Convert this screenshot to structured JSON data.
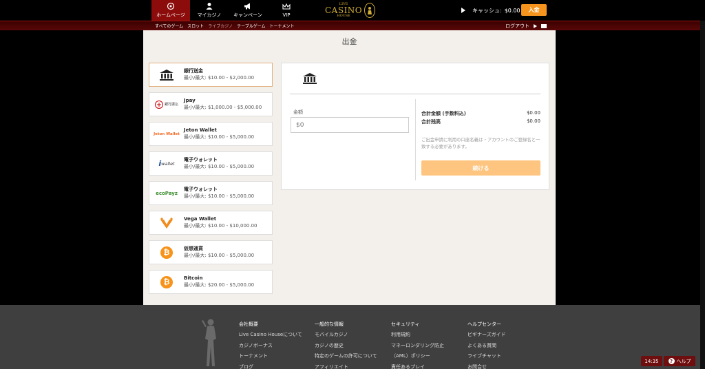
{
  "nav": {
    "items": [
      {
        "label": "ホームページ",
        "icon": "home-icon"
      },
      {
        "label": "マイカジノ",
        "icon": "user-icon"
      },
      {
        "label": "キャンペーン",
        "icon": "megaphone-icon"
      },
      {
        "label": "VIP",
        "icon": "crown-icon"
      }
    ]
  },
  "logo": {
    "small": "LIVE",
    "big": "CASINO",
    "sub": "HOUSE"
  },
  "cashier": {
    "label": "キャッシュ:",
    "balance": "$0.00",
    "deposit_label": "入金"
  },
  "subnav": {
    "links": [
      "すべてのゲーム",
      "スロット",
      "ライブカジノ",
      "テーブルゲーム",
      "トーナメント"
    ],
    "logout_label": "ログアウト"
  },
  "page": {
    "title": "出金"
  },
  "methods": [
    {
      "name": "銀行送金",
      "limits": "最小/最大: $10.00 - $2,000.00",
      "icon": "bank-icon"
    },
    {
      "name": "Jpay",
      "limits": "最小/最大: $1,000.00 - $5,000.00",
      "icon": "jpay-logo",
      "logo_text": "銀行振込"
    },
    {
      "name": "Jeton Wallet",
      "limits": "最小/最大: $10.00 - $5,000.00",
      "icon": "jeton-logo",
      "logo_text": "Jeton Wallet"
    },
    {
      "name": "電子ウォレット",
      "limits": "最小/最大: $10.00 - $5,000.00",
      "icon": "iwallet-logo",
      "logo_text": "wallet"
    },
    {
      "name": "電子ウォレット",
      "limits": "最小/最大: $10.00 - $5,000.00",
      "icon": "ecopayz-logo",
      "logo_text": "ecoPayz"
    },
    {
      "name": "Vega Wallet",
      "limits": "最小/最大: $10.00 - $10,000.00",
      "icon": "vega-logo"
    },
    {
      "name": "仮想通貨",
      "limits": "最小/最大: $10.00 - $5,000.00",
      "icon": "bitcoin-icon"
    },
    {
      "name": "Bitcoin",
      "limits": "最小/最大: $20.00 - $5,000.00",
      "icon": "bitcoin-icon"
    }
  ],
  "withdraw": {
    "amount_label": "金額",
    "amount_placeholder": "$0",
    "total_label": "合計金額 (手数料込)",
    "total_value": "$0.00",
    "balance_label": "合計残高",
    "balance_value": "$0.00",
    "notice": "ご出金申請に利用の口座名義は・アカウントのご登録名と一致する必要があります。",
    "continue_label": "続ける"
  },
  "footer": {
    "columns": [
      {
        "head": "会社概要",
        "links": [
          "Live Casino Houseについて",
          "カジノボーナス",
          "トーナメント",
          "ブログ"
        ]
      },
      {
        "head": "一般的な情報",
        "links": [
          "モバイルカジノ",
          "カジノの歴史",
          "特定のゲームの許可について",
          "アフィリエイト"
        ]
      },
      {
        "head": "セキュリティ",
        "links": [
          "利用規約",
          "マネーロンダリング防止",
          "（AML）ポリシー",
          "責任あるプレイ"
        ]
      },
      {
        "head": "ヘルプセンター",
        "links": [
          "ビギナーズガイド",
          "よくある質問",
          "ライブチャット",
          "お問合せ"
        ]
      }
    ]
  },
  "widgets": {
    "clock": "14:35",
    "help_label": "ヘルプ"
  },
  "colors": {
    "accent": "#f7941d",
    "nav_active": "#8c0b0b",
    "button_light": "#fdc57f",
    "bitcoin": "#f7931a"
  }
}
